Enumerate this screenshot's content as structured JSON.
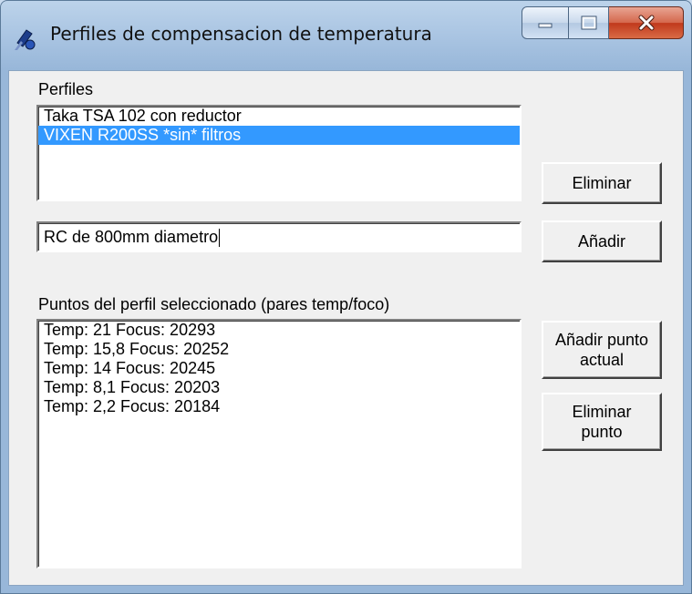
{
  "window": {
    "title": "Perfiles de compensacion de temperatura",
    "icons": {
      "app": "telescope-icon",
      "minimize": "minimize-icon",
      "maximize": "maximize-icon",
      "close": "close-icon"
    }
  },
  "profiles": {
    "label": "Perfiles",
    "items": [
      "Taka TSA 102 con reductor",
      "VIXEN R200SS *sin* filtros"
    ],
    "selected_index": 1,
    "delete_button": "Eliminar",
    "new_profile_value": "RC de 800mm diametro",
    "add_button": "Añadir"
  },
  "points": {
    "label": "Puntos del perfil seleccionado (pares temp/foco)",
    "items": [
      "Temp: 21 Focus: 20293",
      "Temp: 15,8 Focus: 20252",
      "Temp: 14 Focus: 20245",
      "Temp: 8,1 Focus: 20203",
      "Temp: 2,2 Focus: 20184"
    ],
    "add_current_button": [
      "Añadir punto",
      "actual"
    ],
    "delete_point_button": [
      "Eliminar",
      "punto"
    ]
  },
  "colors": {
    "selection": "#3399ff",
    "dialog_bg": "#f0f0f0",
    "close_button": "#c0391c"
  }
}
